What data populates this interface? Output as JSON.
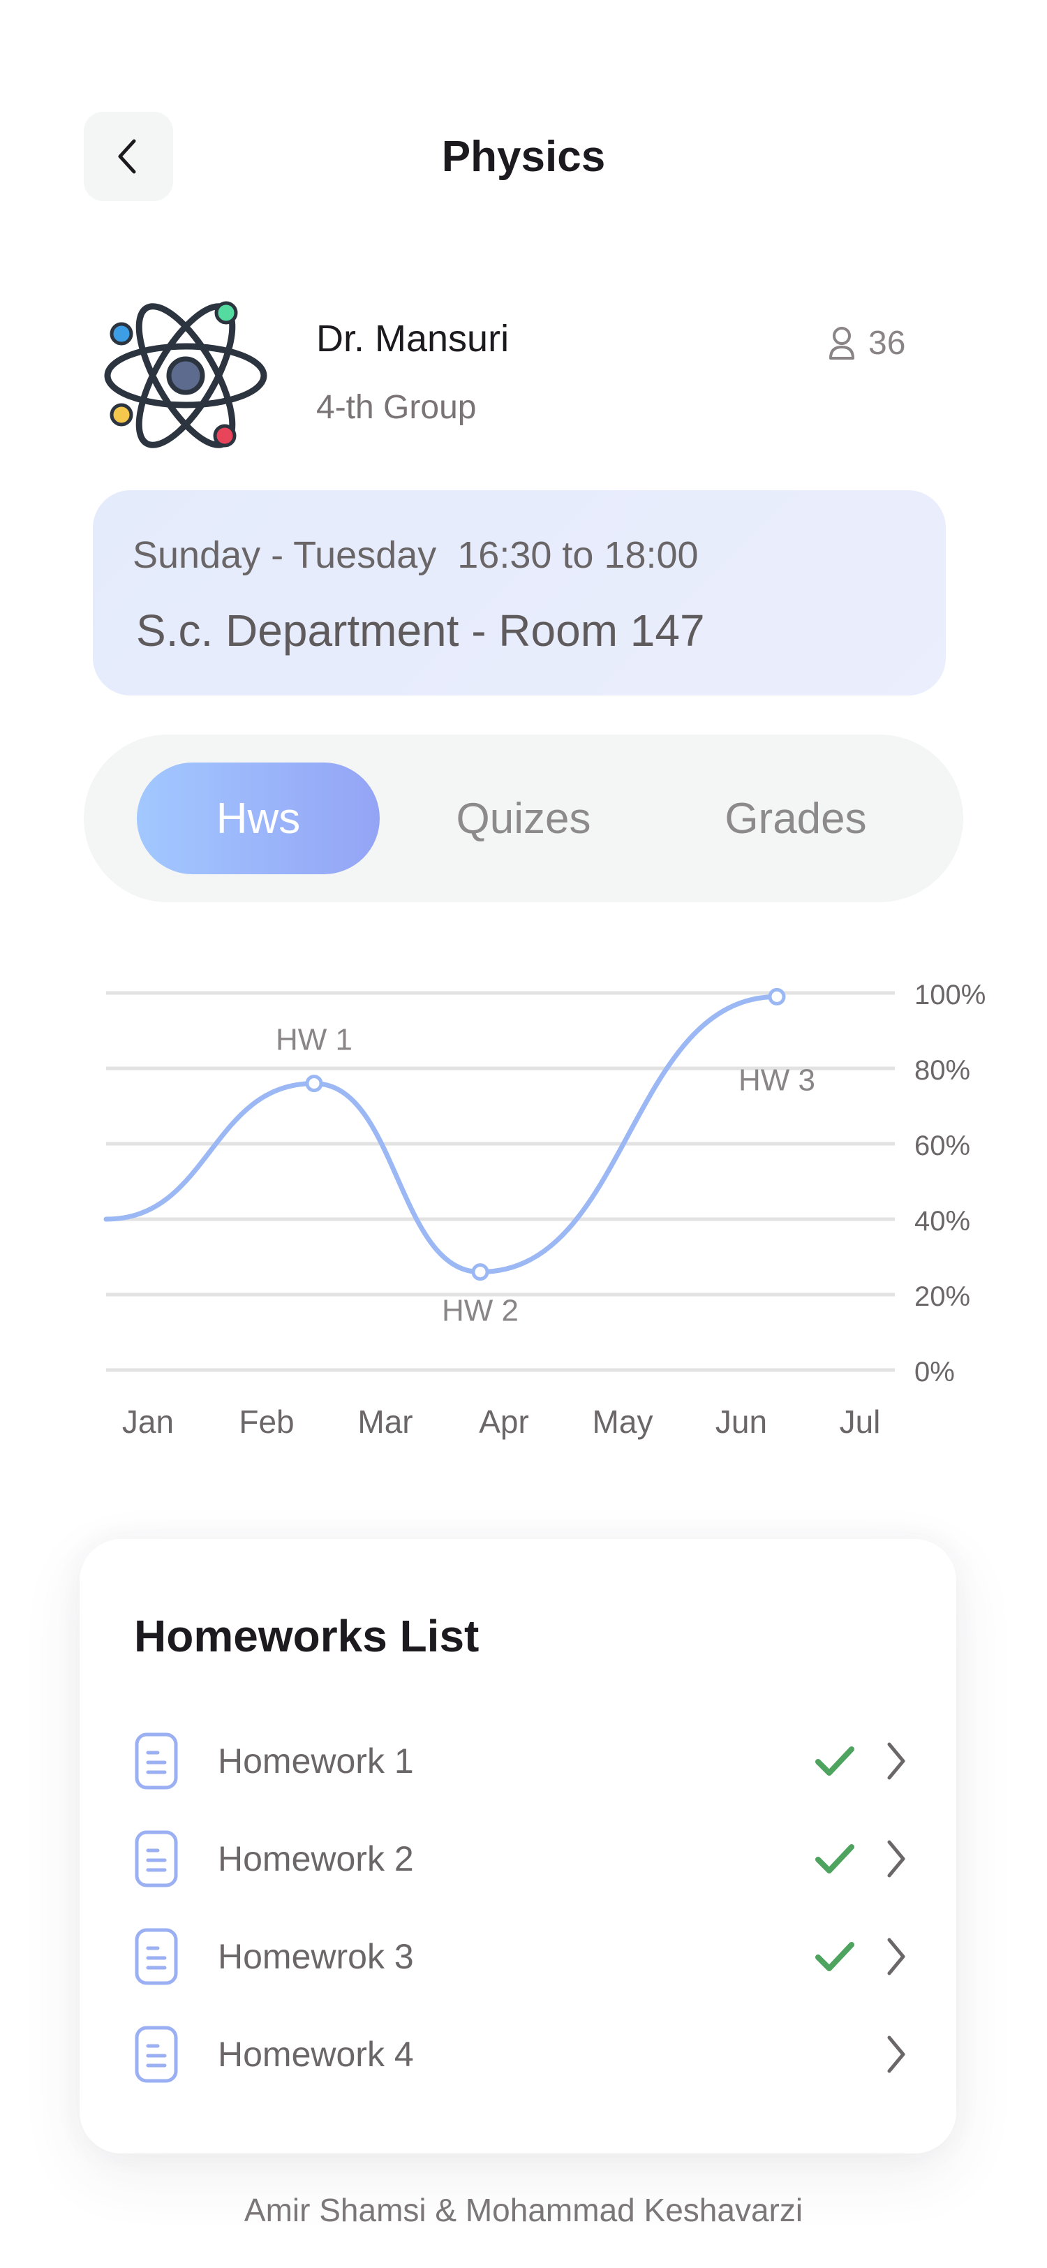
{
  "header": {
    "title": "Physics",
    "back_icon": "chevron-left-icon"
  },
  "teacher": {
    "name": "Dr. Mansuri",
    "group": "4-th Group",
    "students_count": "36",
    "logo_icon": "atom-icon",
    "students_icon": "user-icon"
  },
  "schedule": {
    "days_time": "Sunday - Tuesday  16:30 to 18:00",
    "location": "S.c. Department - Room 147"
  },
  "tabs": [
    {
      "label": "Hws",
      "active": true
    },
    {
      "label": "Quizes",
      "active": false
    },
    {
      "label": "Grades",
      "active": false
    }
  ],
  "chart_data": {
    "type": "line",
    "categories": [
      "Jan",
      "Feb",
      "Mar",
      "Apr",
      "May",
      "Jun",
      "Jul"
    ],
    "y_ticks": [
      "0%",
      "20%",
      "40%",
      "60%",
      "80%",
      "100%"
    ],
    "ylim": [
      0,
      100
    ],
    "series": [
      {
        "x": [
          0,
          1.4,
          2.8,
          5.3
        ],
        "values": [
          40,
          76,
          26,
          99
        ]
      }
    ],
    "annotations": [
      {
        "label": "HW 1",
        "x": 1.4,
        "y": 76
      },
      {
        "label": "HW 2",
        "x": 2.8,
        "y": 26
      },
      {
        "label": "HW 3",
        "x": 5.3,
        "y": 99
      }
    ],
    "grid": true,
    "line_color": "#9bb8f5"
  },
  "homeworks": {
    "title": "Homeworks List",
    "items": [
      {
        "label": "Homework 1",
        "done": true
      },
      {
        "label": "Homework 2",
        "done": true
      },
      {
        "label": "Homewrok 3",
        "done": true
      },
      {
        "label": "Homework 4",
        "done": false
      }
    ]
  },
  "footer": {
    "credits": "Amir Shamsi & Mohammad Keshavarzi"
  },
  "colors": {
    "accent_start": "#a2c8ff",
    "accent_end": "#94a4f5",
    "check": "#4ea35e",
    "doc_icon": "#9bb0f2"
  }
}
